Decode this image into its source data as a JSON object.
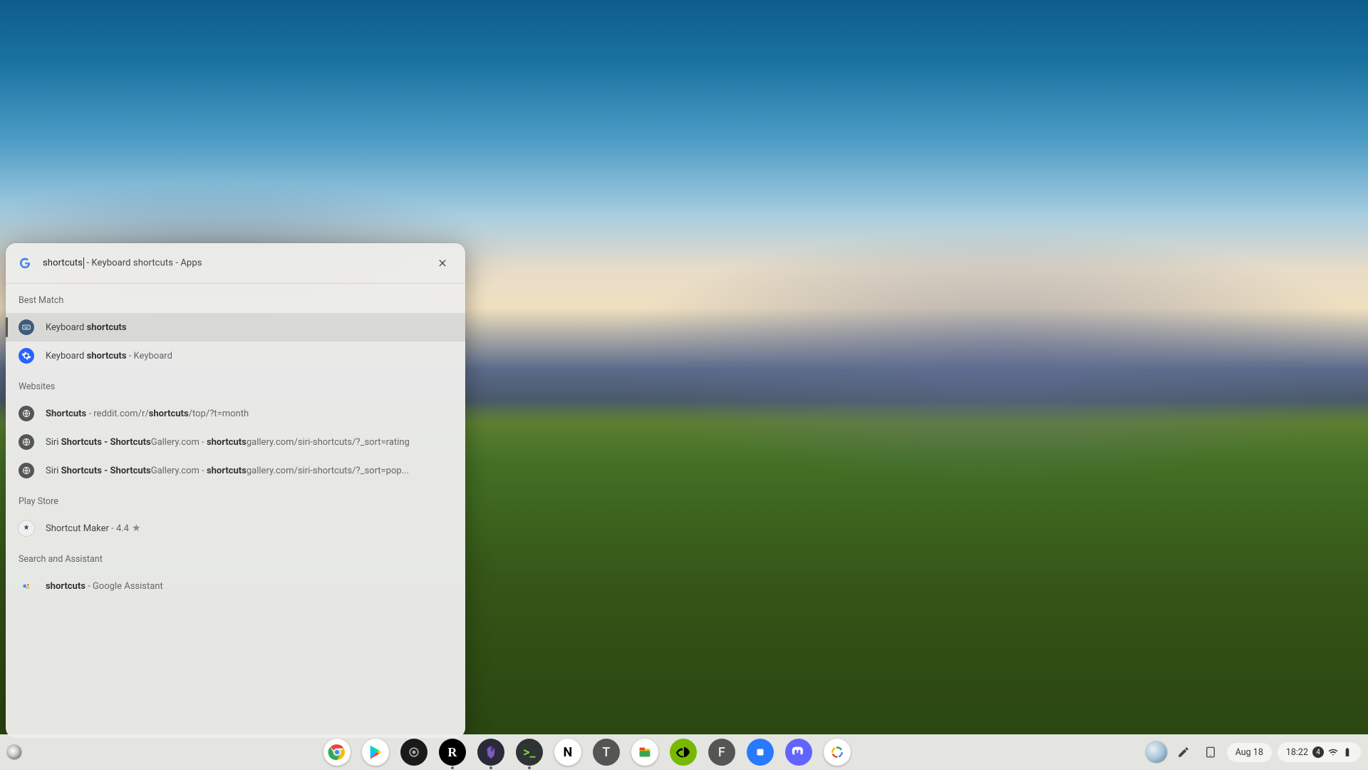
{
  "search": {
    "typed": "shortcuts",
    "completion": " - Keyboard shortcuts - Apps"
  },
  "sections": {
    "best_match": "Best Match",
    "websites": "Websites",
    "play_store": "Play Store",
    "search_assistant": "Search and Assistant"
  },
  "results": {
    "best_match": [
      {
        "prefix": "Keyboard ",
        "bold": "shortcuts",
        "suffix": ""
      },
      {
        "prefix": "Keyboard ",
        "bold": "shortcuts",
        "suffix": " - Keyboard"
      }
    ],
    "websites": [
      {
        "bold1": "Shortcuts",
        "mid1": " - reddit.com/r/",
        "bold2": "shortcuts",
        "mid2": "/top/?t=month"
      },
      {
        "pre": "Siri ",
        "bold1": "Shortcuts - Shortcuts",
        "mid1": "Gallery.com - ",
        "bold2": "shortcuts",
        "mid2": "gallery.com/siri-shortcuts/?_sort=rating"
      },
      {
        "pre": "Siri ",
        "bold1": "Shortcuts - Shortcuts",
        "mid1": "Gallery.com - ",
        "bold2": "shortcuts",
        "mid2": "gallery.com/siri-shortcuts/?_sort=pop..."
      }
    ],
    "play_store": [
      {
        "name": "Shortcut Maker",
        "rating": "4.4"
      }
    ],
    "assistant": [
      {
        "bold": "shortcuts",
        "suffix": " - Google Assistant"
      }
    ]
  },
  "shelf": {
    "apps": [
      {
        "id": "chrome",
        "label": "",
        "cls": "ic-chrome",
        "active": false
      },
      {
        "id": "play-store",
        "label": "",
        "cls": "ic-play",
        "active": false
      },
      {
        "id": "app-3",
        "label": "",
        "cls": "ic-black",
        "active": false
      },
      {
        "id": "app-r",
        "label": "R",
        "cls": "ic-r",
        "active": true
      },
      {
        "id": "obsidian",
        "label": "",
        "cls": "ic-obs",
        "active": true
      },
      {
        "id": "terminal",
        "label": ">_",
        "cls": "ic-term",
        "active": true
      },
      {
        "id": "notion",
        "label": "N",
        "cls": "ic-notion",
        "active": false
      },
      {
        "id": "app-t",
        "label": "T",
        "cls": "ic-t",
        "active": false
      },
      {
        "id": "files",
        "label": "",
        "cls": "ic-files",
        "active": false
      },
      {
        "id": "nvidia",
        "label": "",
        "cls": "ic-nvidia",
        "active": false
      },
      {
        "id": "app-f",
        "label": "F",
        "cls": "ic-f",
        "active": false
      },
      {
        "id": "app-blue",
        "label": "",
        "cls": "ic-blue",
        "active": false
      },
      {
        "id": "mastodon",
        "label": "",
        "cls": "ic-mastodon",
        "active": false
      },
      {
        "id": "app-color",
        "label": "",
        "cls": "ic-color",
        "active": false
      }
    ]
  },
  "tray": {
    "date": "Aug 18",
    "time": "18:22",
    "notification_count": "4"
  }
}
